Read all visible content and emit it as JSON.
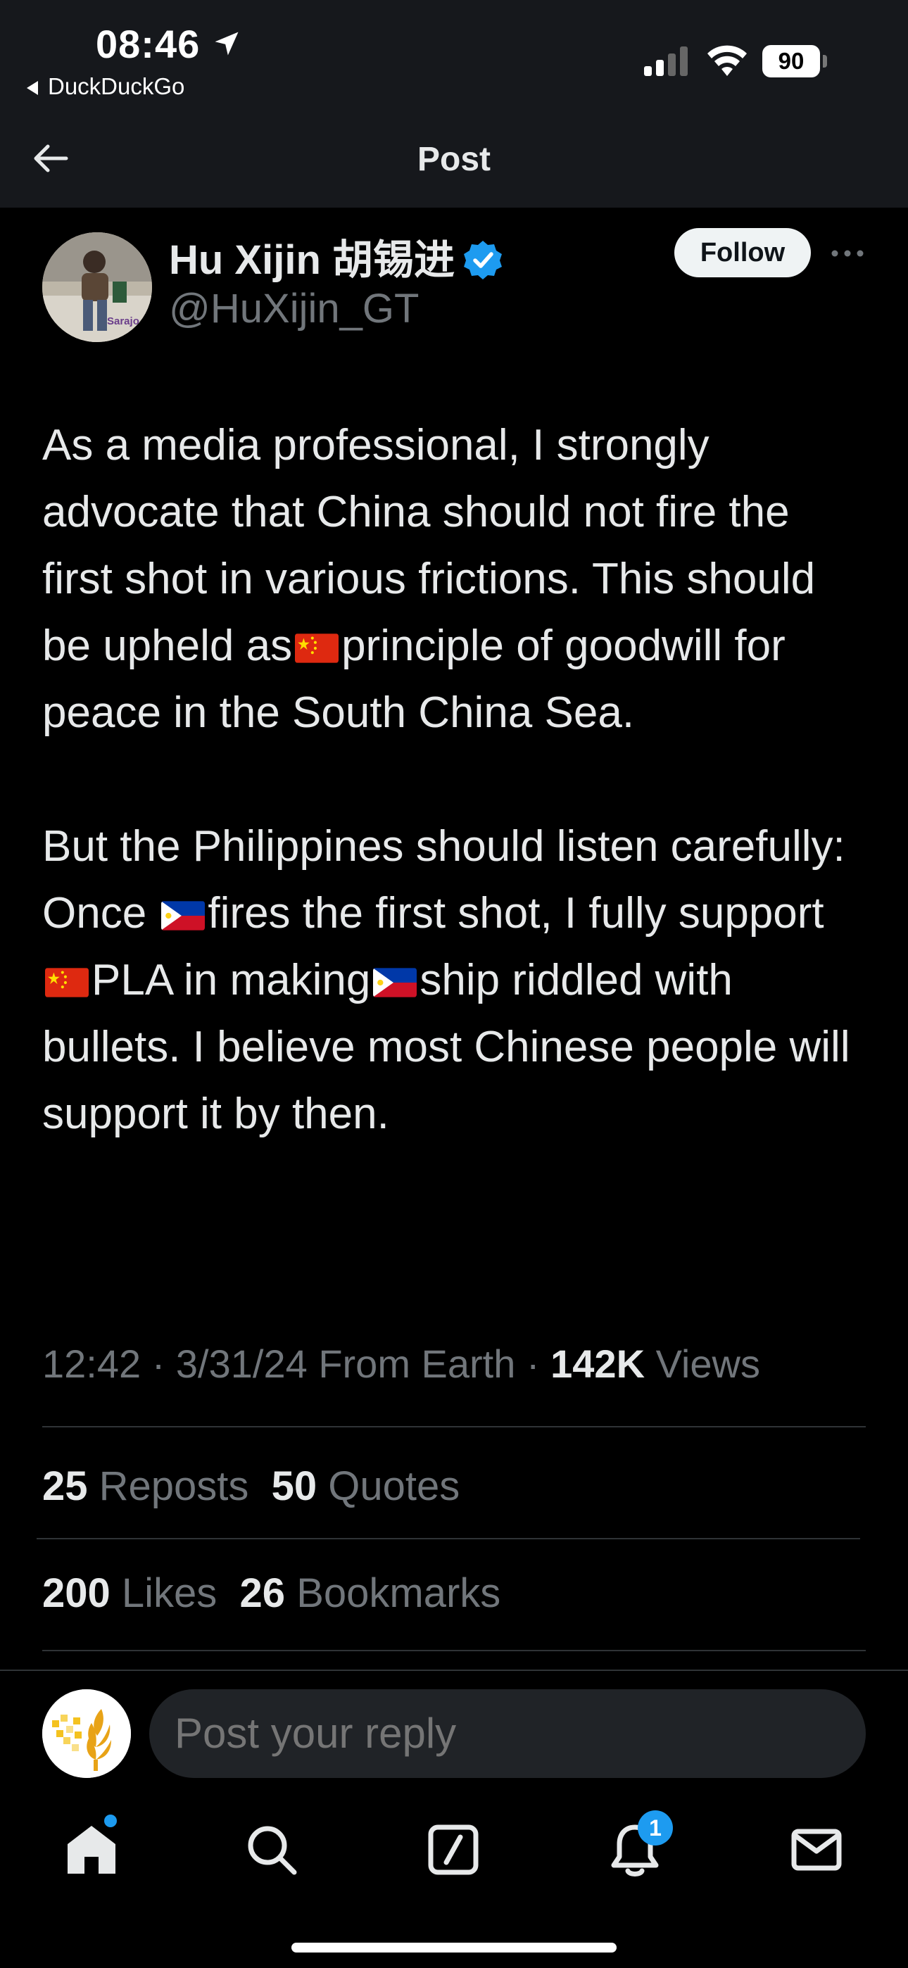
{
  "status_bar": {
    "time": "08:46",
    "back_app": "DuckDuckGo",
    "battery": "90"
  },
  "header": {
    "title": "Post"
  },
  "author": {
    "name": "Hu Xijin 胡锡进",
    "handle": "@HuXijin_GT",
    "avatar_text": "Sarajo",
    "follow_label": "Follow"
  },
  "post": {
    "p1_a": "As a media professional, I strongly advocate that China should not fire the first shot in various frictions. This should be upheld as",
    "p1_b": "principle of goodwill for peace in the South China Sea.",
    "p2_a": "But the Philippines should listen carefully: Once ",
    "p2_b": "fires the first shot, I fully support ",
    "p2_c": "PLA in making",
    "p2_d": "ship riddled with bullets. I believe most Chinese people will support it by then."
  },
  "meta": {
    "time": "12:42",
    "date": "3/31/24",
    "source": "From Earth",
    "views_count": "142K",
    "views_label": "Views"
  },
  "stats": {
    "reposts_count": "25",
    "reposts_label": "Reposts",
    "quotes_count": "50",
    "quotes_label": "Quotes",
    "likes_count": "200",
    "likes_label": "Likes",
    "bookmarks_count": "26",
    "bookmarks_label": "Bookmarks"
  },
  "reply": {
    "placeholder": "Post your reply"
  },
  "tabbar": {
    "items": [
      "home-icon",
      "search-icon",
      "grok-icon",
      "notifications-icon",
      "messages-icon"
    ],
    "notifications_badge": "1"
  },
  "colors": {
    "accent": "#1d9bf0",
    "text": "#e7e9ea",
    "secondary": "#71767b",
    "background": "#000000",
    "header_bg": "#16181c"
  }
}
